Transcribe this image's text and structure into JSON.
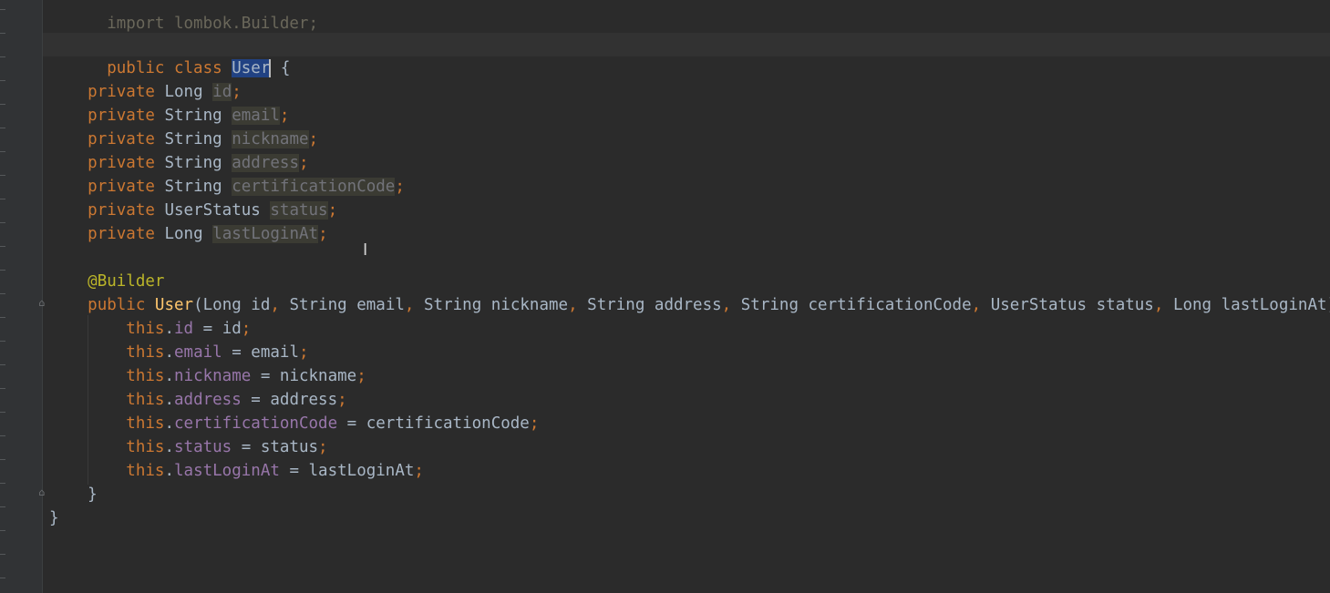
{
  "editor": {
    "lines": {
      "import": "import lombok.Builder;",
      "class_kw1": "public",
      "class_kw2": "class",
      "class_name": "User",
      "class_brace": "{",
      "f1": {
        "mod": "private",
        "type": "Long",
        "name": "id",
        "semi": ";"
      },
      "f2": {
        "mod": "private",
        "type": "String",
        "name": "email",
        "semi": ";"
      },
      "f3": {
        "mod": "private",
        "type": "String",
        "name": "nickname",
        "semi": ";"
      },
      "f4": {
        "mod": "private",
        "type": "String",
        "name": "address",
        "semi": ";"
      },
      "f5": {
        "mod": "private",
        "type": "String",
        "name": "certificationCode",
        "semi": ";"
      },
      "f6": {
        "mod": "private",
        "type": "UserStatus",
        "name": "status",
        "semi": ";"
      },
      "f7": {
        "mod": "private",
        "type": "Long",
        "name": "lastLoginAt",
        "semi": ";"
      },
      "annotation": "@Builder",
      "ctor_kw": "public",
      "ctor_name": "User",
      "ctor_open": "(",
      "p1": "Long id",
      "p2": "String email",
      "p3": "String nickname",
      "p4": "String address",
      "p5": "String certificationCode",
      "p6": "UserStatus status",
      "p7": "Long lastLoginAt",
      "comma": ",",
      "ctor_close": ") {",
      "this_kw": "this",
      "dot": ".",
      "a1": {
        "field": "id",
        "eq": " = ",
        "val": "id"
      },
      "a2": {
        "field": "email",
        "eq": " = ",
        "val": "email"
      },
      "a3": {
        "field": "nickname",
        "eq": " = ",
        "val": "nickname"
      },
      "a4": {
        "field": "address",
        "eq": " = ",
        "val": "address"
      },
      "a5": {
        "field": "certificationCode",
        "eq": " = ",
        "val": "certificationCode"
      },
      "a6": {
        "field": "status",
        "eq": " = ",
        "val": "status"
      },
      "a7": {
        "field": "lastLoginAt",
        "eq": " = ",
        "val": "lastLoginAt"
      },
      "ctor_end": "}",
      "class_end": "}"
    },
    "colors": {
      "background": "#2b2b2b",
      "keyword": "#cc7832",
      "method": "#ffc66d",
      "annotation": "#bbb529",
      "field": "#9876aa",
      "text": "#a9b7c6",
      "selection": "#214283"
    }
  }
}
